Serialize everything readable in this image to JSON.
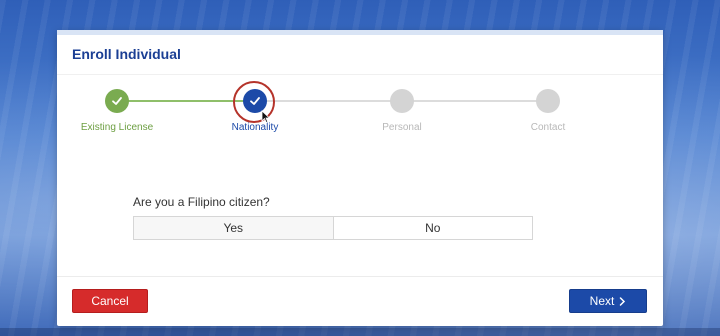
{
  "dialog": {
    "title": "Enroll Individual"
  },
  "stepper": {
    "steps": [
      {
        "label": "Existing License",
        "state": "completed",
        "icon": "check-icon"
      },
      {
        "label": "Nationality",
        "state": "current",
        "icon": "check-icon"
      },
      {
        "label": "Personal",
        "state": "pending"
      },
      {
        "label": "Contact",
        "state": "pending"
      }
    ],
    "colors": {
      "completed": "#7aab50",
      "current": "#1c4aa8",
      "pending": "#d4d4d4",
      "highlight_ring": "#b5332a"
    }
  },
  "question": {
    "text": "Are you a Filipino citizen?",
    "options": [
      "Yes",
      "No"
    ]
  },
  "footer": {
    "cancel_label": "Cancel",
    "next_label": "Next",
    "cancel_color": "#d62b2b",
    "next_color": "#1c4aa8"
  }
}
